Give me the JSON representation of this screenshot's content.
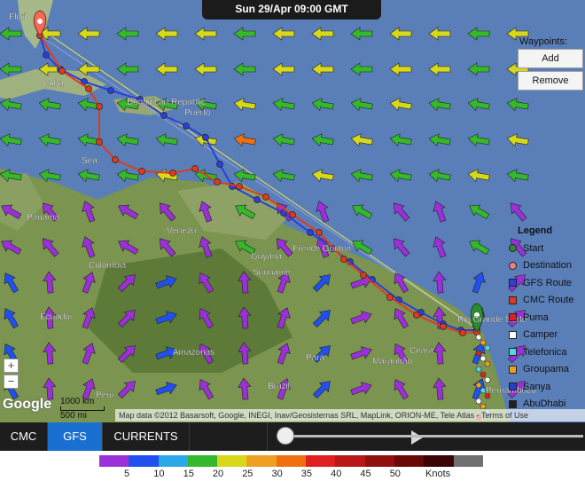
{
  "date_banner": "Sun 29/Apr 09:00 GMT",
  "waypoints": {
    "title": "Waypoints:",
    "add": "Add",
    "remove": "Remove"
  },
  "legend": {
    "title": "Legend",
    "items": [
      {
        "label": "Start",
        "color": "#2e8b2e"
      },
      {
        "label": "Destination",
        "color": "#f08080"
      },
      {
        "label": "GFS Route",
        "color": "#2a3fdb"
      },
      {
        "label": "CMC Route",
        "color": "#e03a1e"
      },
      {
        "label": "Puma",
        "color": "#e02020"
      },
      {
        "label": "Camper",
        "color": "#ffffff"
      },
      {
        "label": "Telefonica",
        "color": "#4fd8e8"
      },
      {
        "label": "Groupama",
        "color": "#f0a020"
      },
      {
        "label": "Sanya",
        "color": "#2040d0"
      },
      {
        "label": "AbuDhabi",
        "color": "#222222"
      }
    ]
  },
  "places": [
    {
      "name": "Flori"
    },
    {
      "name": "Cuba"
    },
    {
      "name": "Dominican Republic"
    },
    {
      "name": "Puerto"
    },
    {
      "name": "Sea"
    },
    {
      "name": "Panama"
    },
    {
      "name": "Venezu"
    },
    {
      "name": "Colombia"
    },
    {
      "name": "Guyana"
    },
    {
      "name": "Suriname"
    },
    {
      "name": "French Guiana"
    },
    {
      "name": "Ecuador"
    },
    {
      "name": "Amazonas"
    },
    {
      "name": "Pará"
    },
    {
      "name": "Maranhão"
    },
    {
      "name": "Ceará"
    },
    {
      "name": "Peru"
    },
    {
      "name": "Brazil"
    },
    {
      "name": "Rio Grande Norte"
    },
    {
      "name": "Pernambuco"
    }
  ],
  "map_controls": {
    "zoom_in": "+",
    "zoom_out": "−"
  },
  "scale": {
    "km": "1000 km",
    "mi": "500 mi"
  },
  "google_logo": "Google",
  "attribution": "Map data ©2012 Basarsoft, Google, INEGI, Inav/Geosistemas SRL, MapLink, ORION-ME, Tele Atlas - Terms of Use",
  "toolbar": {
    "cmc": "CMC",
    "gfs": "GFS",
    "currents": "CURRENTS"
  },
  "timeline": {
    "position": 0.0
  },
  "wind_scale": {
    "unit": "Knots",
    "colors": [
      "#9b30d8",
      "#2050f0",
      "#2aa8e8",
      "#35b82a",
      "#d8d81a",
      "#f0a020",
      "#f07010",
      "#e02020",
      "#b81818",
      "#901010",
      "#6a0808",
      "#3a0404",
      "#707070"
    ],
    "labels": [
      "5",
      "10",
      "15",
      "20",
      "25",
      "30",
      "35",
      "40",
      "45",
      "50"
    ]
  }
}
